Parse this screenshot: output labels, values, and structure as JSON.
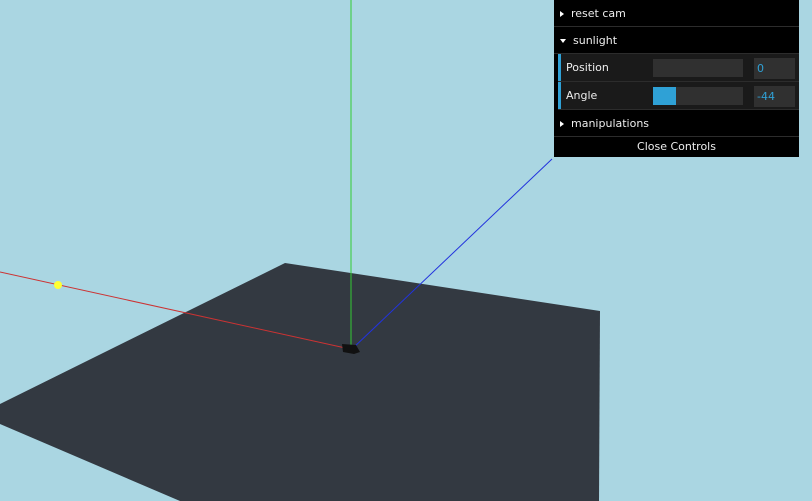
{
  "scene": {
    "background_color": "#aad6e2",
    "ground_color": "#333941",
    "axis_x_color": "#cc3333",
    "axis_y_color": "#33cc33",
    "axis_z_color": "#2233dd",
    "light_marker_color": "#ffff33"
  },
  "gui": {
    "reset_cam": "reset cam",
    "sunlight": {
      "title": "sunlight",
      "expanded": true,
      "position": {
        "label": "Position",
        "value": "0",
        "fill": 0
      },
      "angle": {
        "label": "Angle",
        "value": "-44",
        "fill": 0.25
      }
    },
    "manipulations": "manipulations",
    "close_controls": "Close Controls",
    "accent_color": "#2fa1d6"
  }
}
